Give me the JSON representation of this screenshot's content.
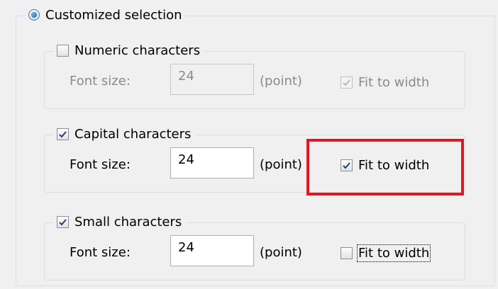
{
  "customized": {
    "label": "Customized selection",
    "selected": true
  },
  "numeric": {
    "label": "Numeric characters",
    "checked": false,
    "enabled": false,
    "font_size_label": "Font size:",
    "font_size_value": "24",
    "unit": "(point)",
    "fit_label": "Fit to width",
    "fit_checked": true
  },
  "capital": {
    "label": "Capital characters",
    "checked": true,
    "enabled": true,
    "font_size_label": "Font size:",
    "font_size_value": "24",
    "unit": "(point)",
    "fit_label": "Fit to width",
    "fit_checked": true
  },
  "small": {
    "label": "Small characters",
    "checked": true,
    "enabled": true,
    "font_size_label": "Font size:",
    "font_size_value": "24",
    "unit": "(point)",
    "fit_label": "Fit to width",
    "fit_checked": false
  },
  "highlight_color": "#e8141c"
}
